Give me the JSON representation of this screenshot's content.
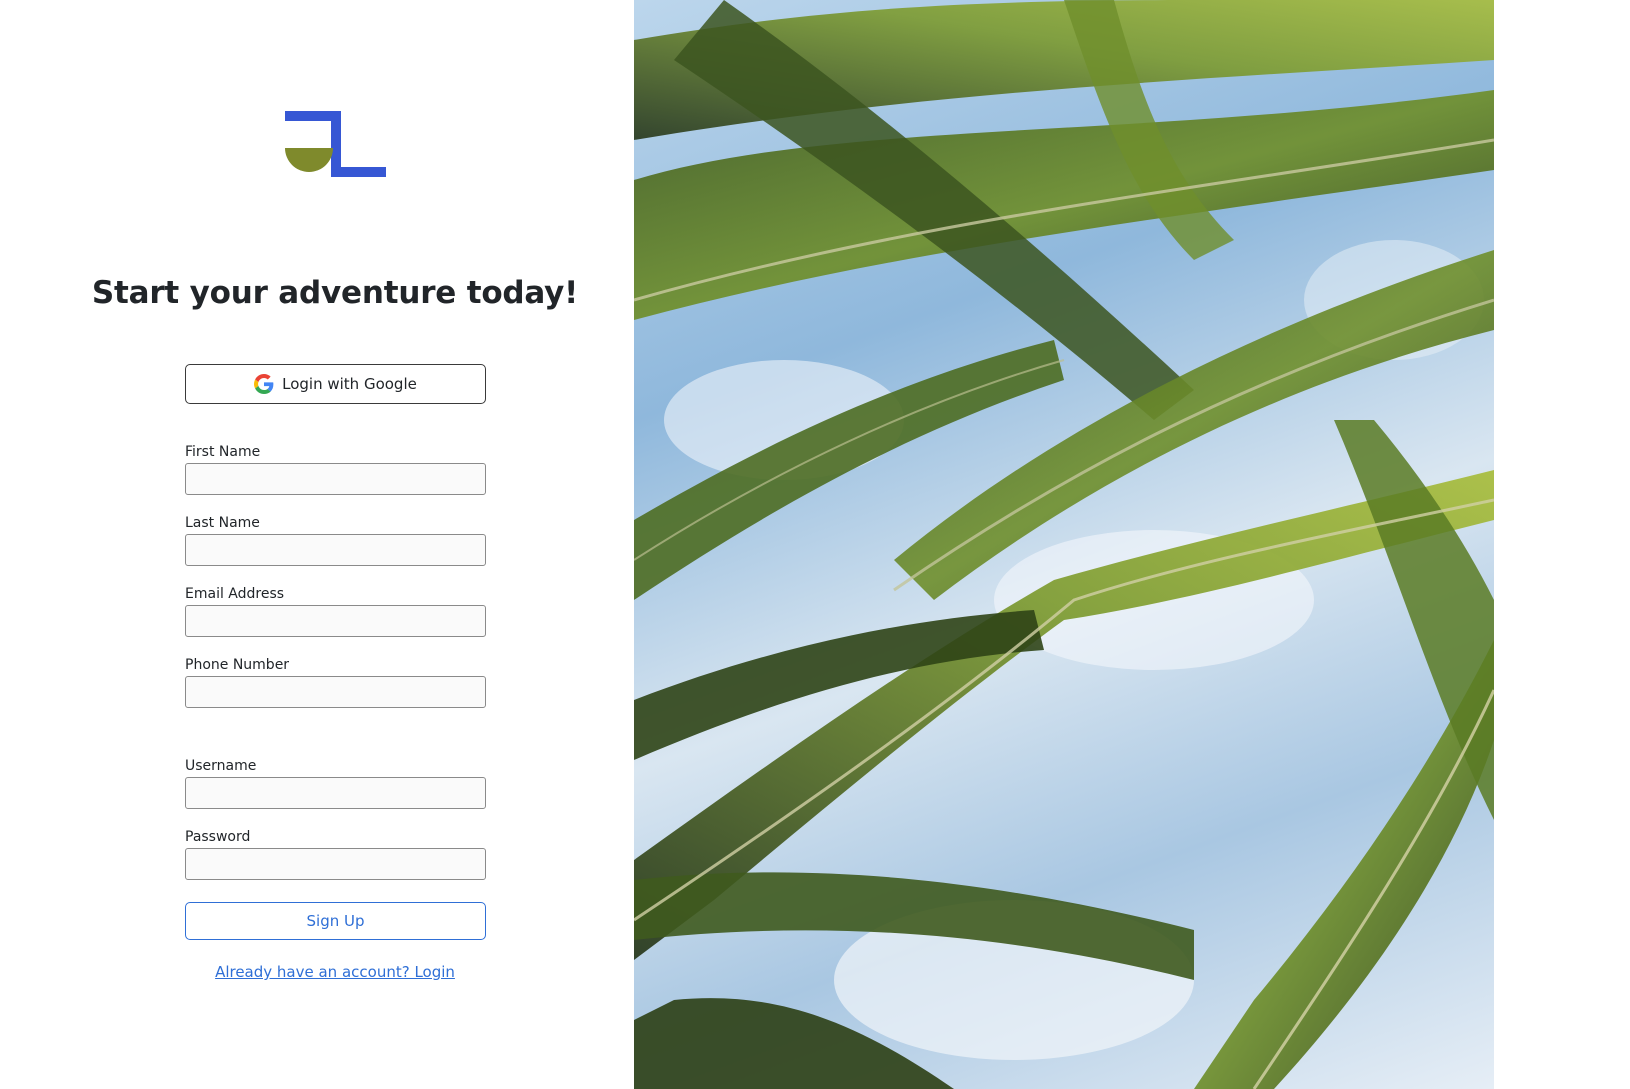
{
  "headline": "Start your adventure today!",
  "google_button": {
    "label": "Login with Google"
  },
  "fields": [
    {
      "label": "First Name",
      "value": ""
    },
    {
      "label": "Last Name",
      "value": ""
    },
    {
      "label": "Email Address",
      "value": ""
    },
    {
      "label": "Phone Number",
      "value": ""
    },
    {
      "label": "Username",
      "value": ""
    },
    {
      "label": "Password",
      "value": ""
    }
  ],
  "signup_button": {
    "label": "Sign Up"
  },
  "login_link": {
    "label": "Already have an account? Login"
  },
  "colors": {
    "logo_blue": "#3657d4",
    "logo_olive": "#7f8a2c",
    "link_blue": "#2f6fd6"
  },
  "icons": {
    "logo": "jl-logo",
    "google": "google-g-icon"
  }
}
